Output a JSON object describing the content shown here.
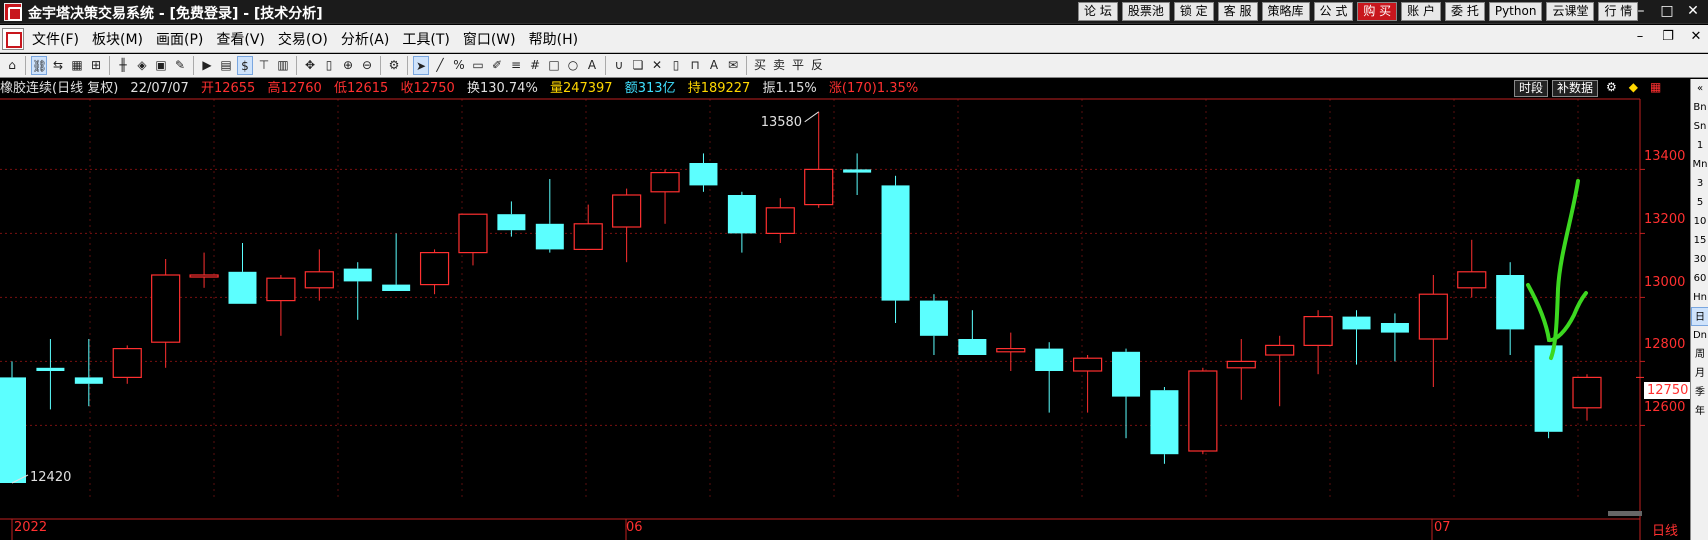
{
  "window": {
    "title": "金宇塔决策交易系统 - [免费登录] - [技术分析]",
    "top_buttons": [
      "论 坛",
      "股票池",
      "锁 定",
      "客 服",
      "策略库",
      "公 式",
      "购 买",
      "账 户",
      "委 托",
      "Python",
      "云课堂",
      "行 情"
    ],
    "hot_button_index": 6
  },
  "menu": {
    "items": [
      "文件(F)",
      "板块(M)",
      "画面(P)",
      "查看(V)",
      "交易(O)",
      "分析(A)",
      "工具(T)",
      "窗口(W)",
      "帮助(H)"
    ]
  },
  "info_bar": {
    "symbol": "橡胶连续(日线 复权)",
    "date": "22/07/07",
    "open": "开12655",
    "high": "高12760",
    "low": "低12615",
    "close": "收12750",
    "turnover": "换130.74%",
    "volume": "量247397",
    "amount": "额313亿",
    "open_interest": "持189227",
    "amplitude": "振1.15%",
    "change": "涨(170)1.35%",
    "btn_period": "时段",
    "btn_supplement": "补数据"
  },
  "axis": {
    "price_labels": [
      "13400",
      "13200",
      "13000",
      "12800",
      "12600"
    ],
    "current_price": "12750",
    "date_labels": [
      "2022",
      "06",
      "07"
    ],
    "period": "日线",
    "high_annotation": "13580",
    "low_annotation": "12420"
  },
  "side_panel": [
    "Bn",
    "Sn",
    "1",
    "Mn",
    "3",
    "5",
    "10",
    "15",
    "30",
    "60",
    "Hn",
    "日",
    "Dn",
    "周",
    "月",
    "季",
    "年"
  ],
  "chart_data": {
    "type": "candlestick",
    "ylim": [
      12370,
      13620
    ],
    "grid": true,
    "candles": [
      {
        "o": 12750,
        "h": 12800,
        "l": 12420,
        "c": 12420
      },
      {
        "o": 12780,
        "h": 12870,
        "l": 12650,
        "c": 12770
      },
      {
        "o": 12750,
        "h": 12870,
        "l": 12660,
        "c": 12730
      },
      {
        "o": 12750,
        "h": 12850,
        "l": 12730,
        "c": 12840
      },
      {
        "o": 12860,
        "h": 13120,
        "l": 12780,
        "c": 13070
      },
      {
        "o": 13070,
        "h": 13140,
        "l": 13030,
        "c": 13070
      },
      {
        "o": 13080,
        "h": 13170,
        "l": 12980,
        "c": 12980
      },
      {
        "o": 12990,
        "h": 13070,
        "l": 12880,
        "c": 13060
      },
      {
        "o": 13030,
        "h": 13150,
        "l": 12990,
        "c": 13080
      },
      {
        "o": 13090,
        "h": 13110,
        "l": 12930,
        "c": 13050
      },
      {
        "o": 13040,
        "h": 13200,
        "l": 13020,
        "c": 13020
      },
      {
        "o": 13040,
        "h": 13150,
        "l": 13010,
        "c": 13140
      },
      {
        "o": 13140,
        "h": 13260,
        "l": 13100,
        "c": 13260
      },
      {
        "o": 13260,
        "h": 13300,
        "l": 13190,
        "c": 13210
      },
      {
        "o": 13230,
        "h": 13370,
        "l": 13140,
        "c": 13150
      },
      {
        "o": 13150,
        "h": 13290,
        "l": 13150,
        "c": 13230
      },
      {
        "o": 13220,
        "h": 13340,
        "l": 13110,
        "c": 13320
      },
      {
        "o": 13330,
        "h": 13400,
        "l": 13230,
        "c": 13390
      },
      {
        "o": 13420,
        "h": 13450,
        "l": 13330,
        "c": 13350
      },
      {
        "o": 13320,
        "h": 13330,
        "l": 13140,
        "c": 13200
      },
      {
        "o": 13200,
        "h": 13310,
        "l": 13170,
        "c": 13280
      },
      {
        "o": 13290,
        "h": 13580,
        "l": 13280,
        "c": 13400
      },
      {
        "o": 13400,
        "h": 13450,
        "l": 13320,
        "c": 13390
      },
      {
        "o": 13350,
        "h": 13380,
        "l": 12920,
        "c": 12990
      },
      {
        "o": 12990,
        "h": 13010,
        "l": 12820,
        "c": 12880
      },
      {
        "o": 12870,
        "h": 12960,
        "l": 12820,
        "c": 12820
      },
      {
        "o": 12830,
        "h": 12890,
        "l": 12770,
        "c": 12840
      },
      {
        "o": 12840,
        "h": 12860,
        "l": 12640,
        "c": 12770
      },
      {
        "o": 12770,
        "h": 12820,
        "l": 12640,
        "c": 12810
      },
      {
        "o": 12830,
        "h": 12840,
        "l": 12560,
        "c": 12690
      },
      {
        "o": 12710,
        "h": 12720,
        "l": 12480,
        "c": 12510
      },
      {
        "o": 12520,
        "h": 12780,
        "l": 12510,
        "c": 12770
      },
      {
        "o": 12780,
        "h": 12870,
        "l": 12680,
        "c": 12800
      },
      {
        "o": 12820,
        "h": 12880,
        "l": 12660,
        "c": 12850
      },
      {
        "o": 12850,
        "h": 12960,
        "l": 12760,
        "c": 12940
      },
      {
        "o": 12940,
        "h": 12960,
        "l": 12790,
        "c": 12900
      },
      {
        "o": 12920,
        "h": 12950,
        "l": 12800,
        "c": 12890
      },
      {
        "o": 12870,
        "h": 13070,
        "l": 12720,
        "c": 13010
      },
      {
        "o": 13030,
        "h": 13180,
        "l": 13000,
        "c": 13080
      },
      {
        "o": 13070,
        "h": 13110,
        "l": 12820,
        "c": 12900
      },
      {
        "o": 12850,
        "h": 12850,
        "l": 12560,
        "c": 12580
      },
      {
        "o": 12655,
        "h": 12760,
        "l": 12615,
        "c": 12750
      }
    ],
    "up_color": "#ff3030",
    "down_color": "#5cffff",
    "annotation_color": "#3cd820"
  }
}
